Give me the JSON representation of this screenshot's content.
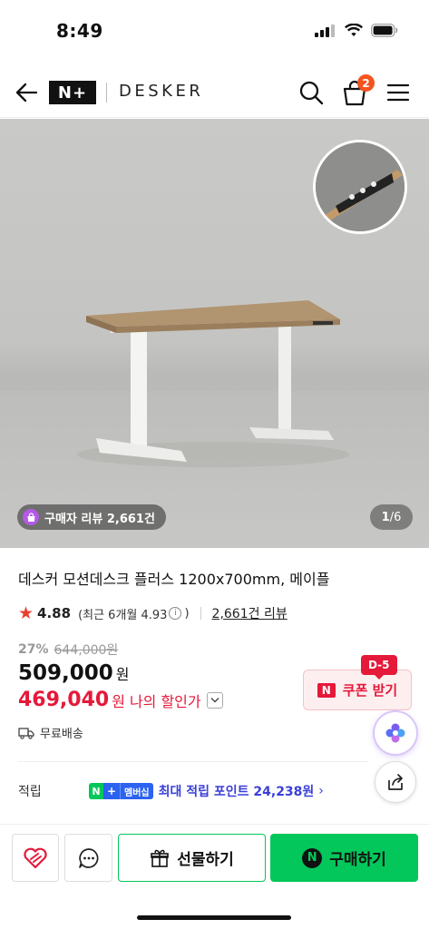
{
  "status": {
    "time": "8:49"
  },
  "header": {
    "logo_mark": "N+",
    "brand": "DESKER",
    "cart_count": "2"
  },
  "hero": {
    "review_chip": "구매자 리뷰 2,661건",
    "page_current": "1",
    "page_total": "/6"
  },
  "product": {
    "title": "데스커 모션데스크 플러스 1200x700mm, 메이플",
    "rating": "4.88",
    "recent_rating": "(최근 6개월 4.93",
    "recent_close": ")",
    "review_link": "2,661건 리뷰",
    "discount_rate": "27%",
    "original_price": "644,000원",
    "price": "509,000",
    "price_unit": "원",
    "my_price": "469,040",
    "my_price_unit": "원",
    "my_price_label": "나의 할인가",
    "coupon_dday": "D-5",
    "coupon_label": "쿠폰 받기",
    "shipping": "무료배송"
  },
  "points": {
    "label": "적립",
    "badge_n": "N",
    "badge_plus": "+",
    "badge_member": "멤버십",
    "text": "최대 적립 포인트 24,238원",
    "chevron": "›"
  },
  "bottom": {
    "gift_label": "선물하기",
    "buy_label": "구매하기",
    "buy_logo": "N"
  },
  "colors": {
    "naver_green": "#03c75a",
    "price_red": "#e5193a",
    "points_blue": "#3a3fd8",
    "badge_orange": "#f4541f"
  }
}
